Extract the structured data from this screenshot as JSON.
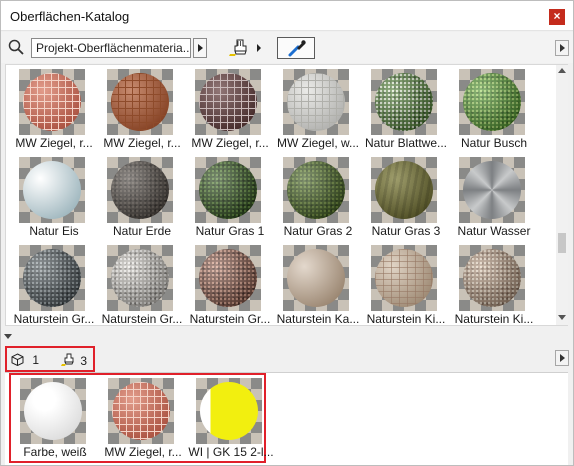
{
  "window": {
    "title": "Oberflächen-Katalog",
    "close_label": "×"
  },
  "toolbar": {
    "search_icon": "search-icon",
    "source_value": "Projekt-Oberflächenmateria..."
  },
  "catalog": {
    "items": [
      {
        "label": "MW Ziegel, r...",
        "color": "#d87b64",
        "pattern": "brick-red"
      },
      {
        "label": "MW Ziegel, r...",
        "color": "#b66540",
        "pattern": "brick-orange"
      },
      {
        "label": "MW Ziegel, r...",
        "color": "#6c4848",
        "pattern": "brick-dark"
      },
      {
        "label": "MW Ziegel, w...",
        "color": "#e4e4e0",
        "pattern": "brick-white"
      },
      {
        "label": "Natur Blattwe...",
        "color": "#4c7a32",
        "pattern": "leaves"
      },
      {
        "label": "Natur Busch",
        "color": "#4d8f2e",
        "pattern": "bush"
      },
      {
        "label": "Natur Eis",
        "color": "#c9dbe0",
        "pattern": "ice"
      },
      {
        "label": "Natur Erde",
        "color": "#4b4540",
        "pattern": "soil"
      },
      {
        "label": "Natur Gras 1",
        "color": "#2d4a1f",
        "pattern": "grass1"
      },
      {
        "label": "Natur Gras 2",
        "color": "#3f5a22",
        "pattern": "grass2"
      },
      {
        "label": "Natur Gras 3",
        "color": "#6c6a36",
        "pattern": "grass3"
      },
      {
        "label": "Natur Wasser",
        "color": "#9a9c9e",
        "pattern": "water"
      },
      {
        "label": "Naturstein Gr...",
        "color": "#4a5256",
        "pattern": "granite-dark"
      },
      {
        "label": "Naturstein Gr...",
        "color": "#b9b6b0",
        "pattern": "granite-light"
      },
      {
        "label": "Naturstein Gr...",
        "color": "#7a5043",
        "pattern": "granite-red"
      },
      {
        "label": "Naturstein Ka...",
        "color": "#c7b19a",
        "pattern": "limestone"
      },
      {
        "label": "Naturstein Ki...",
        "color": "#cdb8a0",
        "pattern": "pebble-light"
      },
      {
        "label": "Naturstein Ki...",
        "color": "#a98e78",
        "pattern": "pebble"
      }
    ]
  },
  "info": {
    "objects_count": "1",
    "surfaces_count": "3"
  },
  "used": {
    "items": [
      {
        "label": "Farbe, weiß",
        "color": "#f6f6f6",
        "pattern": "plain-white"
      },
      {
        "label": "MW Ziegel, r...",
        "color": "#d87b64",
        "pattern": "brick-red"
      },
      {
        "label": "WI | GK 15 2-l...",
        "color": "#f0ee10",
        "pattern": "yellow"
      }
    ]
  },
  "colors": {
    "highlight": "#e0202a",
    "close": "#c42b1c"
  }
}
